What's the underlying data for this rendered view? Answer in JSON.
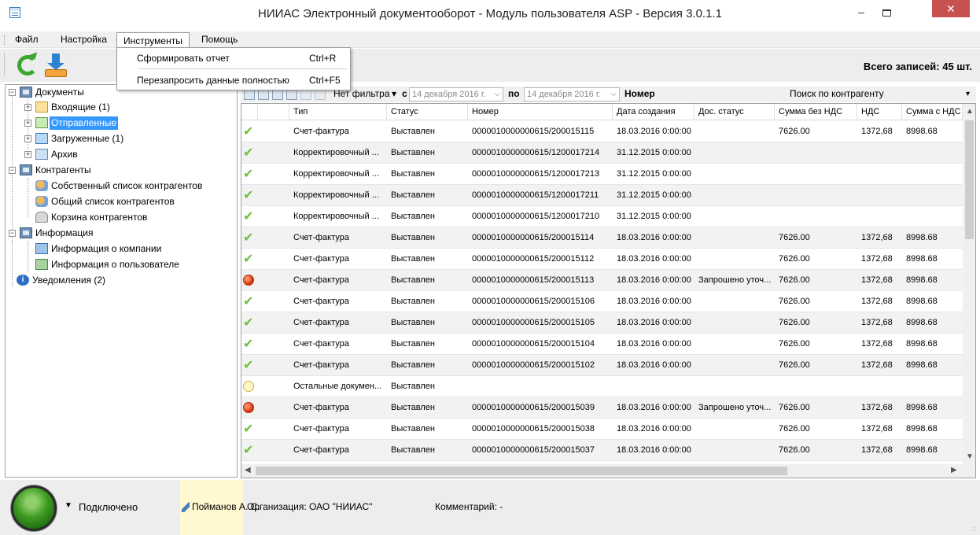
{
  "window": {
    "title": "НИИАС Электронный документооборот - Модуль пользователя ASP - Версия 3.0.1.1",
    "min_label": "–",
    "close_label": "✕"
  },
  "menu": {
    "file": "Файл",
    "settings": "Настройка",
    "tools": "Инструменты",
    "help": "Помощь"
  },
  "tools_menu": {
    "items": [
      {
        "label": "Сформировать отчет",
        "shortcut": "Ctrl+R"
      },
      {
        "label": "Перезапросить данные полностью",
        "shortcut": "Ctrl+F5"
      }
    ]
  },
  "toolbar": {
    "refresh_icon": "refresh-icon",
    "download_icon": "download-icon",
    "total_records": "Всего записей: 45 шт."
  },
  "tree": {
    "documents": "Документы",
    "incoming": "Входящие (1)",
    "sent": "Отправленные",
    "loaded": "Загруженные (1)",
    "archive": "Архив",
    "contractors": "Контрагенты",
    "own_list": "Собственный список контрагентов",
    "common_list": "Общий список контрагентов",
    "contractor_bin": "Корзина контрагентов",
    "info": "Информация",
    "company_info": "Информация о компании",
    "user_info": "Информация о пользователе",
    "notifications": "Уведомления (2)"
  },
  "filter": {
    "no_filter": "Нет фильтра",
    "from": "с",
    "date_from": "14  декабря  2016 г.",
    "to": "по",
    "date_to": "14  декабря  2016 г.",
    "number": "Номер",
    "search_contractor": "Поиск по контрагенту"
  },
  "grid": {
    "columns": [
      "Тип",
      "Статус",
      "Номер",
      "Дата создания",
      "Дос. статус",
      "Сумма без НДС",
      "НДС",
      "Сумма с НДС"
    ],
    "rows": [
      {
        "icon": "check",
        "type": "Счет-фактура",
        "status": "Выставлен",
        "number": "0000010000000615/200015115",
        "date": "18.03.2016 0:00:00",
        "doc_status": "",
        "sum": "7626.00",
        "vat": "1372,68",
        "total": "8998.68"
      },
      {
        "icon": "check",
        "type": "Корректировочный ...",
        "status": "Выставлен",
        "number": "0000010000000615/1200017214",
        "date": "31.12.2015 0:00:00",
        "doc_status": "",
        "sum": "",
        "vat": "",
        "total": ""
      },
      {
        "icon": "check",
        "type": "Корректировочный ...",
        "status": "Выставлен",
        "number": "0000010000000615/1200017213",
        "date": "31.12.2015 0:00:00",
        "doc_status": "",
        "sum": "",
        "vat": "",
        "total": ""
      },
      {
        "icon": "check",
        "type": "Корректировочный ...",
        "status": "Выставлен",
        "number": "0000010000000615/1200017211",
        "date": "31.12.2015 0:00:00",
        "doc_status": "",
        "sum": "",
        "vat": "",
        "total": ""
      },
      {
        "icon": "check",
        "type": "Корректировочный ...",
        "status": "Выставлен",
        "number": "0000010000000615/1200017210",
        "date": "31.12.2015 0:00:00",
        "doc_status": "",
        "sum": "",
        "vat": "",
        "total": ""
      },
      {
        "icon": "check",
        "type": "Счет-фактура",
        "status": "Выставлен",
        "number": "0000010000000615/200015114",
        "date": "18.03.2016 0:00:00",
        "doc_status": "",
        "sum": "7626.00",
        "vat": "1372,68",
        "total": "8998.68"
      },
      {
        "icon": "check",
        "type": "Счет-фактура",
        "status": "Выставлен",
        "number": "0000010000000615/200015112",
        "date": "18.03.2016 0:00:00",
        "doc_status": "",
        "sum": "7626.00",
        "vat": "1372,68",
        "total": "8998.68"
      },
      {
        "icon": "red",
        "type": "Счет-фактура",
        "status": "Выставлен",
        "number": "0000010000000615/200015113",
        "date": "18.03.2016 0:00:00",
        "doc_status": "Запрошено уточ...",
        "sum": "7626.00",
        "vat": "1372,68",
        "total": "8998.68"
      },
      {
        "icon": "check",
        "type": "Счет-фактура",
        "status": "Выставлен",
        "number": "0000010000000615/200015106",
        "date": "18.03.2016 0:00:00",
        "doc_status": "",
        "sum": "7626.00",
        "vat": "1372,68",
        "total": "8998.68"
      },
      {
        "icon": "check",
        "type": "Счет-фактура",
        "status": "Выставлен",
        "number": "0000010000000615/200015105",
        "date": "18.03.2016 0:00:00",
        "doc_status": "",
        "sum": "7626.00",
        "vat": "1372,68",
        "total": "8998.68"
      },
      {
        "icon": "check",
        "type": "Счет-фактура",
        "status": "Выставлен",
        "number": "0000010000000615/200015104",
        "date": "18.03.2016 0:00:00",
        "doc_status": "",
        "sum": "7626.00",
        "vat": "1372,68",
        "total": "8998.68"
      },
      {
        "icon": "check",
        "type": "Счет-фактура",
        "status": "Выставлен",
        "number": "0000010000000615/200015102",
        "date": "18.03.2016 0:00:00",
        "doc_status": "",
        "sum": "7626.00",
        "vat": "1372,68",
        "total": "8998.68"
      },
      {
        "icon": "yellow",
        "type": "Остальные докумен...",
        "status": "Выставлен",
        "number": "",
        "date": "",
        "doc_status": "",
        "sum": "",
        "vat": "",
        "total": ""
      },
      {
        "icon": "red",
        "type": "Счет-фактура",
        "status": "Выставлен",
        "number": "0000010000000615/200015039",
        "date": "18.03.2016 0:00:00",
        "doc_status": "Запрошено уточ...",
        "sum": "7626.00",
        "vat": "1372,68",
        "total": "8998.68"
      },
      {
        "icon": "check",
        "type": "Счет-фактура",
        "status": "Выставлен",
        "number": "0000010000000615/200015038",
        "date": "18.03.2016 0:00:00",
        "doc_status": "",
        "sum": "7626.00",
        "vat": "1372,68",
        "total": "8998.68"
      },
      {
        "icon": "check",
        "type": "Счет-фактура",
        "status": "Выставлен",
        "number": "0000010000000615/200015037",
        "date": "18.03.2016 0:00:00",
        "doc_status": "",
        "sum": "7626.00",
        "vat": "1372,68",
        "total": "8998.68"
      }
    ]
  },
  "status_bar": {
    "connected": "Подключено",
    "user": "Пойманов А. С.",
    "organization": "Организация:  ОАО \"НИИАС\"",
    "comment": "Комментарий:  -"
  }
}
